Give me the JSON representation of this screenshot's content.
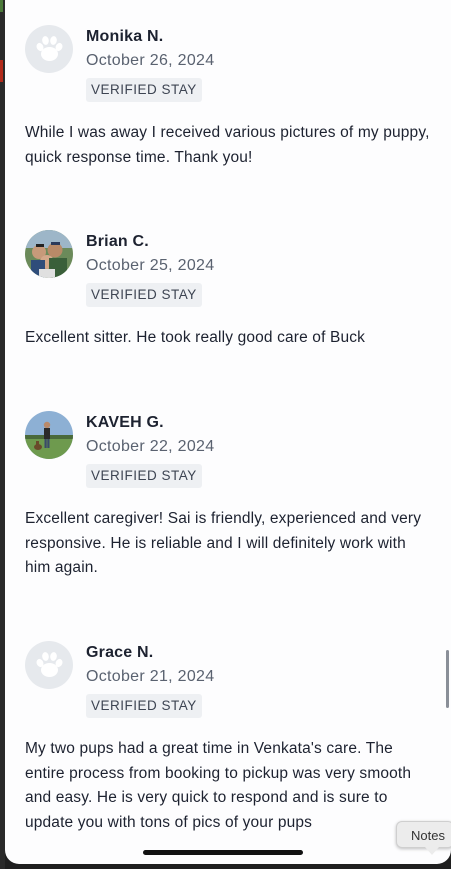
{
  "reviews": [
    {
      "name": "Monika N.",
      "date": "October 26, 2024",
      "badge": "VERIFIED STAY",
      "avatar": "paw-icon",
      "text": "While I was away I received various pictures of my puppy, quick response time. Thank you!"
    },
    {
      "name": "Brian C.",
      "date": "October 25, 2024",
      "badge": "VERIFIED STAY",
      "avatar": "photo",
      "text": "Excellent sitter. He took really good care of Buck"
    },
    {
      "name": "KAVEH G.",
      "date": "October 22, 2024",
      "badge": "VERIFIED STAY",
      "avatar": "photo",
      "text": "Excellent caregiver! Sai is friendly, experienced and very responsive. He is reliable and I will definitely work with him again."
    },
    {
      "name": "Grace N.",
      "date": "October 21, 2024",
      "badge": "VERIFIED STAY",
      "avatar": "paw-icon",
      "text": "My two pups had a great time in Venkata's care. The entire process from booking to pickup was very smooth and easy. He is very quick to respond and is sure to update you with tons of pics of your pups"
    }
  ],
  "tooltip": {
    "label": "Notes"
  },
  "colors": {
    "text": "#1d2230",
    "secondary": "#5a6270",
    "badge_bg": "#eef0f3",
    "avatar_placeholder": "#e6e9ed",
    "paw": "#ffffff"
  }
}
